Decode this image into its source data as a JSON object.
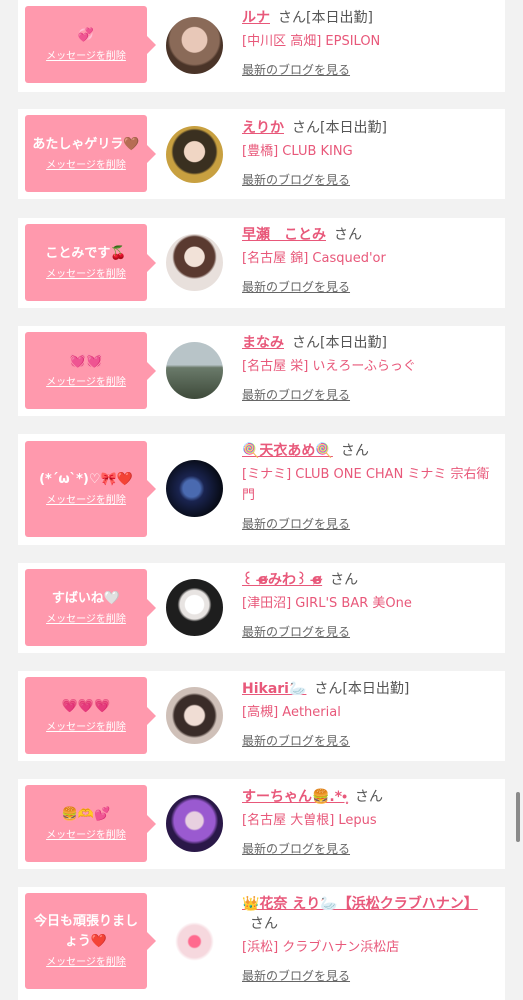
{
  "delete_label": "メッセージを削除",
  "san_label": "さん",
  "today_label": "[本日出勤]",
  "blog_label": "最新のブログを見る",
  "items": [
    {
      "message": "💞",
      "name": "ルナ",
      "today": true,
      "store": "[中川区 高畑] EPSILON",
      "avatar_colors": [
        "#c9a48f",
        "#6b4a3a"
      ]
    },
    {
      "message": "あたしゃゲリラ🤎",
      "name": "えりか",
      "today": true,
      "store": "[豊橋] CLUB KING",
      "avatar_colors": [
        "#d9b45a",
        "#2a2a1a"
      ]
    },
    {
      "message": "ことみです🍒",
      "name": "早瀬　ことみ",
      "today": false,
      "store": "[名古屋 錦] Casqued'or",
      "avatar_colors": [
        "#e8dcd4",
        "#3d2a25"
      ]
    },
    {
      "message": "💓💓",
      "name": "まなみ",
      "today": true,
      "store": "[名古屋 栄] いえろーふらっぐ",
      "avatar_colors": [
        "#a8b4b8",
        "#4e5a48"
      ]
    },
    {
      "message": "(*´ω`*)♡🎀❤️",
      "name": "🍭天衣あめ🍭",
      "today": false,
      "store": "[ミナミ] CLUB ONE CHAN ミナミ 宗右衛門",
      "avatar_colors": [
        "#3a4a7a",
        "#0c1020"
      ]
    },
    {
      "message": "すばいね🤍",
      "name": "꒰ ɞ̴̶̷みわ꒱ ɞ̴̶̷",
      "today": false,
      "store": "[津田沼] GIRL'S BAR 美One",
      "avatar_colors": [
        "#f4f0ee",
        "#222222"
      ]
    },
    {
      "message": "💗💗💗",
      "name": "Hikari🦢",
      "today": true,
      "store": "[高槻] Aetherial",
      "avatar_colors": [
        "#d8c8c0",
        "#3a2e2a"
      ]
    },
    {
      "message": "🍔🫶💕",
      "name": "すーちゃん🍔.*•̩̩͙",
      "today": false,
      "store": "[名古屋 大曽根] Lepus",
      "avatar_colors": [
        "#a06ad0",
        "#2a1a4a"
      ]
    },
    {
      "message": "今日も頑張りましょう❤️",
      "name": "👑花奈 えり🦢【浜松クラブハナン】",
      "today": false,
      "store": "[浜松] クラブハナン浜松店",
      "avatar_colors": [
        "#fbe4ea",
        "#ffffff"
      ]
    }
  ]
}
